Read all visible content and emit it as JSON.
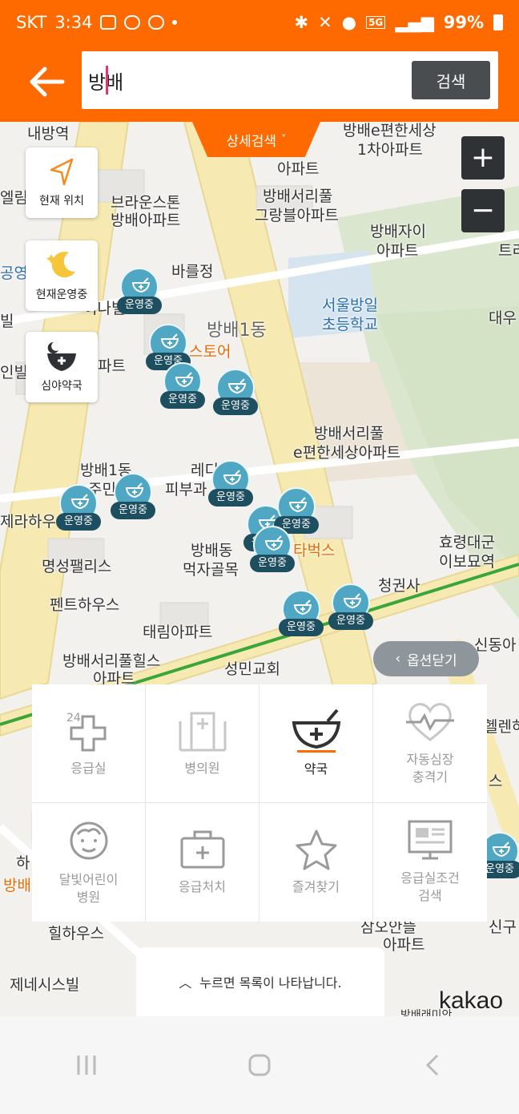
{
  "status": {
    "carrier": "SKT",
    "time": "3:34",
    "network": "5G",
    "battery": "99%"
  },
  "header": {
    "back_icon": "arrow-left-icon",
    "search_value": "방배",
    "search_button": "검색"
  },
  "map": {
    "detail_search": "상세검색",
    "detail_arrow": "˅",
    "zoom_in": "+",
    "zoom_out": "−",
    "side_buttons": {
      "current_location": "현재 위치",
      "open_now": "현재운영중",
      "night_pharmacy": "심야약국"
    },
    "labels": {
      "l1": "방배e편한세상",
      "l2": "1차아파트",
      "l3": "아파트",
      "l4": "브라운스톤",
      "l5": "방배아파트",
      "l6": "방배서리풀",
      "l7": "그랑블아파트",
      "l8": "방배자이",
      "l9": "아파트",
      "l10": "바를정",
      "l11": "서울방일",
      "l12": "초등학교",
      "l13": "방배1동",
      "l14": "스토어",
      "l15": "방배서리풀",
      "l16": "e편한세상아파트",
      "l17": "방배1동",
      "l18": "주민센",
      "l19": "레디",
      "l20": "피부과",
      "l21": "방배동",
      "l22": "먹자골목",
      "l23": "타벅스",
      "l24": "효령대군",
      "l25": "이보묘역",
      "l26": "명성팰리스",
      "l27": "청권사",
      "l28": "펜트하우스",
      "l29": "태림아파트",
      "l30": "방배서리풀힐스",
      "l31": "아파트",
      "l32": "성민교회",
      "l33": "내방역",
      "l34": "엘림",
      "l35": "공영",
      "l36": "빌",
      "l37": "인빌",
      "l38": "파트",
      "l39": "이나빌",
      "l40": "트리",
      "l41": "대우",
      "l42": "제라하우",
      "l43": "신동아",
      "l44": "헬렌하",
      "l45": "스",
      "l46": "방배",
      "l47": "힐하우스",
      "l48": "삼오안뜰",
      "l49": "아파트",
      "l50": "제네시스빌",
      "l51": "신구",
      "l52": "하",
      "l53": "방배래미안"
    },
    "marker_label": "운영중",
    "option_close": "옵션닫기",
    "kakao_logo": "kakao"
  },
  "categories": [
    {
      "label": "응급실",
      "icon": "emergency-24-icon",
      "active": false
    },
    {
      "label": "병의원",
      "icon": "hospital-icon",
      "active": false
    },
    {
      "label": "약국",
      "icon": "pharmacy-bowl-icon",
      "active": true
    },
    {
      "label": "자동심장\n충격기",
      "icon": "heart-pulse-icon",
      "active": false
    },
    {
      "label": "달빛어린이\n병원",
      "icon": "child-face-icon",
      "active": false
    },
    {
      "label": "응급처치",
      "icon": "first-aid-kit-icon",
      "active": false
    },
    {
      "label": "즐겨찾기",
      "icon": "star-icon",
      "active": false
    },
    {
      "label": "응급실조건\n검색",
      "icon": "monitor-search-icon",
      "active": false
    }
  ],
  "list_hint": "누르면 목록이 나타납니다.",
  "colors": {
    "brand": "#ff6a00",
    "marker": "#4fa7c3",
    "marker_tag": "#1e4f61",
    "road": "#f5e6a6"
  }
}
